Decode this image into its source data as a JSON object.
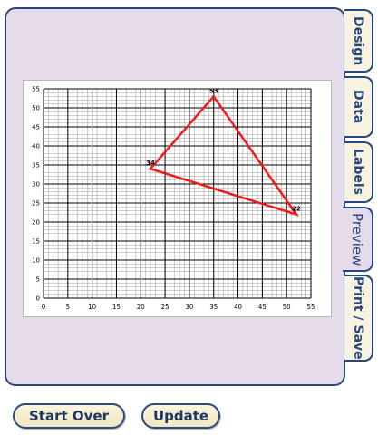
{
  "tabs": [
    {
      "label": "Design",
      "active": false
    },
    {
      "label": "Data",
      "active": false
    },
    {
      "label": "Labels",
      "active": false
    },
    {
      "label": "Preview",
      "active": true
    },
    {
      "label": "Print / Save",
      "active": false
    }
  ],
  "buttons": {
    "start_over": "Start Over",
    "update": "Update"
  },
  "colors": {
    "panel": "#e6dbe8",
    "border": "#27477e",
    "tab_bg": "#f7f3e0",
    "line": "#ee1c1c",
    "grid_major": "#000000",
    "grid_minor": "#9a9a9a"
  },
  "chart_data": {
    "type": "line",
    "title": "",
    "xlabel": "",
    "ylabel": "",
    "xlim": [
      0,
      55
    ],
    "ylim": [
      0,
      55
    ],
    "grid": true,
    "x_ticks": [
      0,
      5,
      10,
      15,
      20,
      25,
      30,
      35,
      40,
      45,
      50,
      55
    ],
    "y_ticks": [
      0,
      5,
      10,
      15,
      20,
      25,
      30,
      35,
      40,
      45,
      50,
      55
    ],
    "series": [
      {
        "closed": true,
        "points": [
          {
            "x": 22,
            "y": 34,
            "label": "34"
          },
          {
            "x": 35,
            "y": 53,
            "label": "53"
          },
          {
            "x": 52,
            "y": 22,
            "label": "22"
          }
        ]
      }
    ]
  }
}
